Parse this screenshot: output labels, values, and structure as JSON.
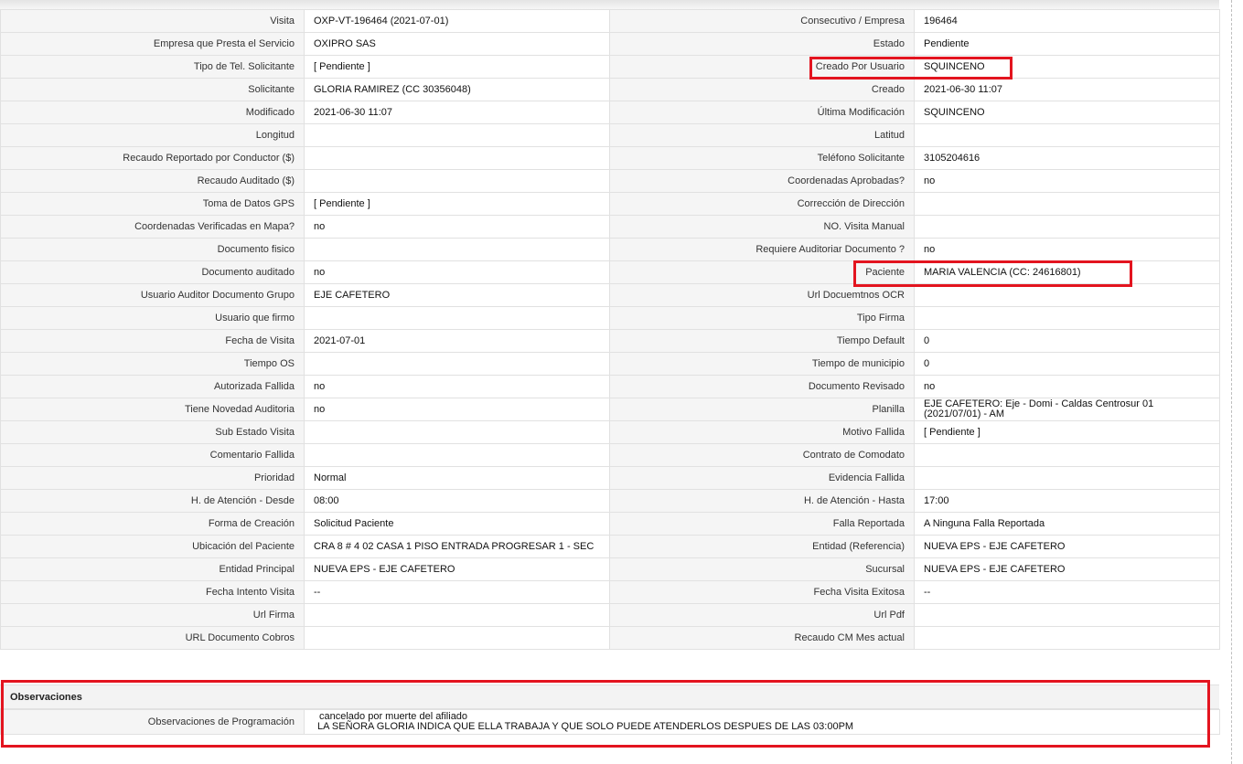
{
  "details": [
    {
      "l1": "Visita",
      "v1": "OXP-VT-196464 (2021-07-01)",
      "l2": "Consecutivo / Empresa",
      "v2": "196464"
    },
    {
      "l1": "Empresa que Presta el Servicio",
      "v1": "OXIPRO SAS",
      "l2": "Estado",
      "v2": "Pendiente"
    },
    {
      "l1": "Tipo de Tel. Solicitante",
      "v1": "[ Pendiente ]",
      "l2": "Creado Por Usuario",
      "v2": "SQUINCENO"
    },
    {
      "l1": "Solicitante",
      "v1": "GLORIA RAMIREZ (CC 30356048)",
      "l2": "Creado",
      "v2": "2021-06-30 11:07"
    },
    {
      "l1": "Modificado",
      "v1": "2021-06-30 11:07",
      "l2": "Última Modificación",
      "v2": " SQUINCENO"
    },
    {
      "l1": "Longitud",
      "v1": "",
      "l2": "Latitud",
      "v2": ""
    },
    {
      "l1": "Recaudo Reportado por Conductor ($)",
      "v1": "",
      "l2": "Teléfono Solicitante",
      "v2": "3105204616"
    },
    {
      "l1": "Recaudo Auditado ($)",
      "v1": "",
      "l2": "Coordenadas Aprobadas?",
      "v2": " no"
    },
    {
      "l1": "Toma de Datos GPS",
      "v1": "[ Pendiente ]",
      "l2": "Corrección de Dirección",
      "v2": ""
    },
    {
      "l1": "Coordenadas Verificadas en Mapa?",
      "v1": " no",
      "l2": "NO. Visita Manual",
      "v2": ""
    },
    {
      "l1": "Documento fisico",
      "v1": "",
      "l2": "Requiere Auditoriar Documento ?",
      "v2": " no"
    },
    {
      "l1": "Documento auditado",
      "v1": " no",
      "l2": "Paciente",
      "v2": "MARIA VALENCIA (CC: 24616801)"
    },
    {
      "l1": "Usuario Auditor Documento Grupo",
      "v1": "EJE CAFETERO",
      "l2": "Url Docuemtnos OCR",
      "v2": ""
    },
    {
      "l1": "Usuario que firmo",
      "v1": "",
      "l2": "Tipo Firma",
      "v2": ""
    },
    {
      "l1": "Fecha de Visita",
      "v1": " 2021-07-01",
      "l2": "Tiempo Default",
      "v2": "0"
    },
    {
      "l1": "Tiempo OS",
      "v1": "",
      "l2": "Tiempo de municipio",
      "v2": "0"
    },
    {
      "l1": "Autorizada Fallida",
      "v1": " no",
      "l2": "Documento Revisado",
      "v2": " no"
    },
    {
      "l1": "Tiene Novedad Auditoria",
      "v1": " no",
      "l2": "Planilla",
      "v2": "EJE CAFETERO: Eje - Domi - Caldas Centrosur 01 (2021/07/01) - AM"
    },
    {
      "l1": "Sub Estado Visita",
      "v1": "",
      "l2": "Motivo Fallida",
      "v2": "[ Pendiente ]"
    },
    {
      "l1": "Comentario Fallida",
      "v1": "",
      "l2": "Contrato de Comodato",
      "v2": ""
    },
    {
      "l1": "Prioridad",
      "v1": "Normal",
      "l2": "Evidencia Fallida",
      "v2": ""
    },
    {
      "l1": "H. de Atención - Desde",
      "v1": "08:00",
      "l2": "H. de Atención - Hasta",
      "v2": "17:00"
    },
    {
      "l1": "Forma de Creación",
      "v1": "Solicitud Paciente",
      "l2": "Falla Reportada",
      "v2": "A Ninguna Falla Reportada"
    },
    {
      "l1": "Ubicación del Paciente",
      "v1": "CRA 8 # 4 02 CASA 1 PISO ENTRADA PROGRESAR 1 - SEC",
      "l2": "Entidad (Referencia)",
      "v2": "NUEVA EPS - EJE CAFETERO"
    },
    {
      "l1": "Entidad Principal",
      "v1": "NUEVA EPS - EJE CAFETERO",
      "l2": "Sucursal",
      "v2": "NUEVA EPS - EJE CAFETERO"
    },
    {
      "l1": "Fecha Intento Visita",
      "v1": " --",
      "l2": "Fecha Visita Exitosa",
      "v2": " --"
    },
    {
      "l1": "Url Firma",
      "v1": "",
      "l2": "Url Pdf",
      "v2": ""
    },
    {
      "l1": "URL Documento Cobros",
      "v1": "",
      "l2": "Recaudo CM Mes actual",
      "v2": ""
    }
  ],
  "observaciones": {
    "title": "Observaciones",
    "label": "Observaciones de Programación",
    "lines": [
      "cancelado por muerte del afiliado",
      "LA SEÑORA GLORIA INDICA QUE ELLA TRABAJA Y QUE SOLO PUEDE ATENDERLOS DESPUES DE LAS 03:00PM"
    ]
  },
  "highlight_color": "#e3141f"
}
